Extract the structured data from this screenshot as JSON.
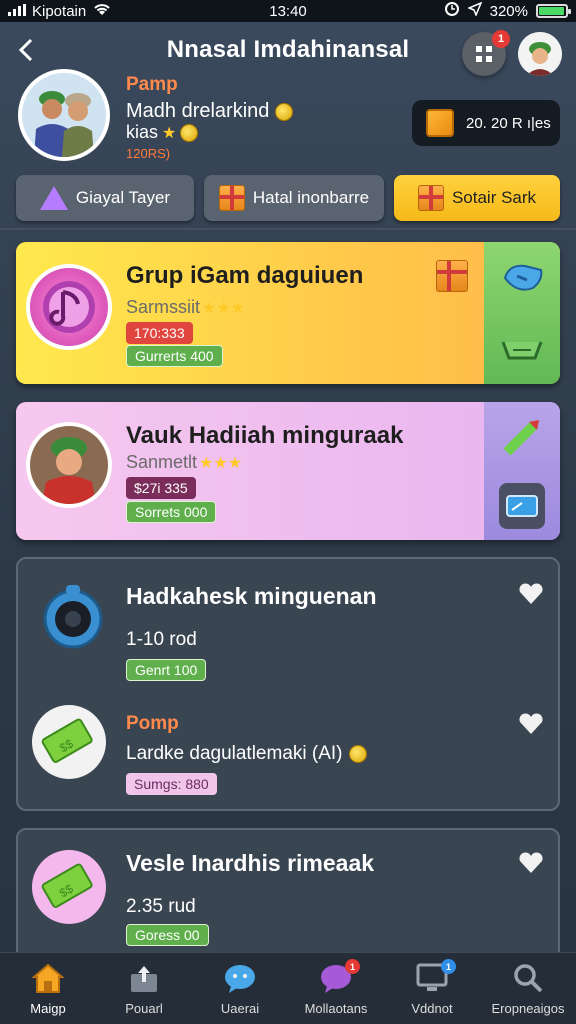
{
  "status_bar": {
    "carrier": "Kipotain",
    "time": "13:40",
    "battery": "320%",
    "battery_level": 0.95
  },
  "header": {
    "title": "Nnasal Imdahinansal",
    "grid_badge": "1"
  },
  "profile": {
    "name": "Pamp",
    "line1": "Madh drelarkind",
    "line2": "kias",
    "line3": "120RS)"
  },
  "currency": {
    "value": "20. 20 R ı|es"
  },
  "tabs": [
    {
      "label": "Giayal Tayer"
    },
    {
      "label": "Hatal inonbarre"
    },
    {
      "label": "Sotair Sark"
    }
  ],
  "cards": {
    "card1": {
      "title": "Grup iGam daguiuen",
      "subtitle": "Sarmssiit",
      "stars": "★★★",
      "tag": "170:333",
      "reward": "Gurrerts 400"
    },
    "card2": {
      "title": "Vauk Hadiiah minguraak",
      "subtitle": "Sanmetlt",
      "stars": "★★★",
      "tag": "$27i 335",
      "reward": "Sorrets 000"
    },
    "card3": {
      "item1_title": "Hadkahesk minguenan",
      "item1_value": "1-10 rod",
      "item1_reward": "Genrt 100",
      "item2_name": "Pomp",
      "item2_text": "Lardke dagulatlemaki (AI)",
      "item2_tag": "Sumgs: 880"
    },
    "card4": {
      "title": "Vesle Inardhis rimeaak",
      "value": "2.35 rud",
      "reward": "Goress 00"
    }
  },
  "bottom_nav": [
    {
      "label": "Maigp",
      "icon": "home-icon",
      "active": true
    },
    {
      "label": "Pouarl",
      "icon": "upload-icon"
    },
    {
      "label": "Uaerai",
      "icon": "chat-bubble-icon"
    },
    {
      "label": "Mollaotans",
      "icon": "message-icon",
      "badge": "1"
    },
    {
      "label": "Vddnot",
      "icon": "screen-icon",
      "badge": "1"
    },
    {
      "label": "Eropneaigos",
      "icon": "search-icon"
    }
  ],
  "colors": {
    "accent_yellow": "#ffc94a",
    "accent_green": "#5fb04d",
    "accent_orange": "#ff8a4c",
    "badge_red": "#e53935",
    "badge_blue": "#2f8fe8"
  }
}
